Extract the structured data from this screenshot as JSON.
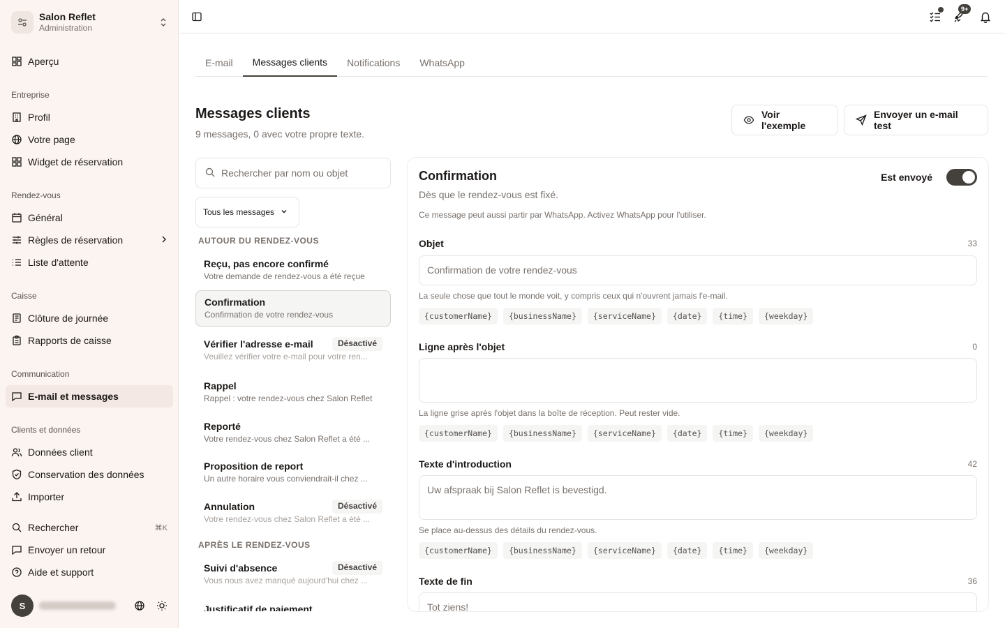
{
  "org": {
    "name": "Salon Reflet",
    "subtitle": "Administration"
  },
  "sidebar": {
    "top": [
      {
        "label": "Aperçu",
        "icon": "dashboard-icon"
      }
    ],
    "sections": [
      {
        "title": "Entreprise",
        "items": [
          {
            "label": "Profil",
            "icon": "building-icon"
          },
          {
            "label": "Votre page",
            "icon": "globe-icon"
          },
          {
            "label": "Widget de réservation",
            "icon": "widget-icon"
          }
        ]
      },
      {
        "title": "Rendez-vous",
        "items": [
          {
            "label": "Général",
            "icon": "calendar-icon"
          },
          {
            "label": "Règles de réservation",
            "icon": "sliders-icon"
          },
          {
            "label": "Liste d'attente",
            "icon": "list-icon"
          }
        ]
      },
      {
        "title": "Caisse",
        "items": [
          {
            "label": "Clôture de journée",
            "icon": "receipt-icon"
          },
          {
            "label": "Rapports de caisse",
            "icon": "clipboard-icon"
          }
        ]
      },
      {
        "title": "Communication",
        "items": [
          {
            "label": "E-mail et messages",
            "icon": "message-icon"
          }
        ]
      },
      {
        "title": "Clients et données",
        "items": [
          {
            "label": "Données client",
            "icon": "users-icon"
          },
          {
            "label": "Conservation des données",
            "icon": "shield-icon"
          },
          {
            "label": "Importer",
            "icon": "upload-icon"
          }
        ]
      }
    ],
    "bottom": [
      {
        "label": "Rechercher",
        "icon": "search-icon",
        "shortcut": "⌘K"
      },
      {
        "label": "Envoyer un retour",
        "icon": "message-icon"
      },
      {
        "label": "Aide et support",
        "icon": "help-icon"
      }
    ],
    "user": {
      "initial": "S"
    }
  },
  "topbar": {
    "notifications_badge": "9+"
  },
  "tabs": [
    "E-mail",
    "Messages clients",
    "Notifications",
    "WhatsApp"
  ],
  "page": {
    "title": "Messages clients",
    "subtitle": "9 messages, 0 avec votre propre texte.",
    "preview_button": "Voir l'exemple",
    "test_button": "Envoyer un e-mail test"
  },
  "search": {
    "placeholder": "Rechercher par nom ou objet"
  },
  "filter": {
    "selected": "Tous les messages"
  },
  "groups": {
    "before": "AUTOUR DU RENDEZ-VOUS",
    "after": "APRÈS LE RENDEZ-VOUS"
  },
  "messages": [
    {
      "title": "Reçu, pas encore confirmé",
      "sub": "Votre demande de rendez-vous a été reçue",
      "status": ""
    },
    {
      "title": "Confirmation",
      "sub": "Confirmation de votre rendez-vous",
      "status": ""
    },
    {
      "title": "Vérifier l'adresse e-mail",
      "sub": "Veuillez vérifier votre e-mail pour votre ren...",
      "status": "Désactivé"
    },
    {
      "title": "Rappel",
      "sub": "Rappel : votre rendez-vous chez Salon Reflet",
      "status": ""
    },
    {
      "title": "Reporté",
      "sub": "Votre rendez-vous chez Salon Reflet a été ...",
      "status": ""
    },
    {
      "title": "Proposition de report",
      "sub": "Un autre horaire vous conviendrait-il chez ...",
      "status": ""
    },
    {
      "title": "Annulation",
      "sub": "Votre rendez-vous chez Salon Reflet a été ...",
      "status": "Désactivé"
    },
    {
      "title": "Suivi d'absence",
      "sub": "Vous nous avez manqué aujourd'hui chez ...",
      "status": "Désactivé"
    },
    {
      "title": "Justificatif de paiement",
      "sub": "",
      "status": ""
    }
  ],
  "editor": {
    "title": "Confirmation",
    "subtitle": "Dès que le rendez-vous est fixé.",
    "note": "Ce message peut aussi partir par WhatsApp. Activez WhatsApp pour l'utiliser.",
    "toggle_label": "Est envoyé",
    "toggle_on": true,
    "fields": [
      {
        "label": "Objet",
        "count": "33",
        "value": "Confirmation de votre rendez-vous",
        "help": "La seule chose que tout le monde voit, y compris ceux qui n'ouvrent jamais l'e-mail."
      },
      {
        "label": "Ligne après l'objet",
        "count": "0",
        "value": "",
        "help": "La ligne grise après l'objet dans la boîte de réception. Peut rester vide."
      },
      {
        "label": "Texte d'introduction",
        "count": "42",
        "value": "Uw afspraak bij Salon Reflet is bevestigd.",
        "help": "Se place au-dessus des détails du rendez-vous."
      },
      {
        "label": "Texte de fin",
        "count": "36",
        "value": "Tot ziens!",
        "help": ""
      }
    ],
    "chips": [
      "{customerName}",
      "{businessName}",
      "{serviceName}",
      "{date}",
      "{time}",
      "{weekday}"
    ]
  },
  "colors": {
    "sidebar_bg": "#fbf4f1",
    "accent": "#44403c"
  }
}
